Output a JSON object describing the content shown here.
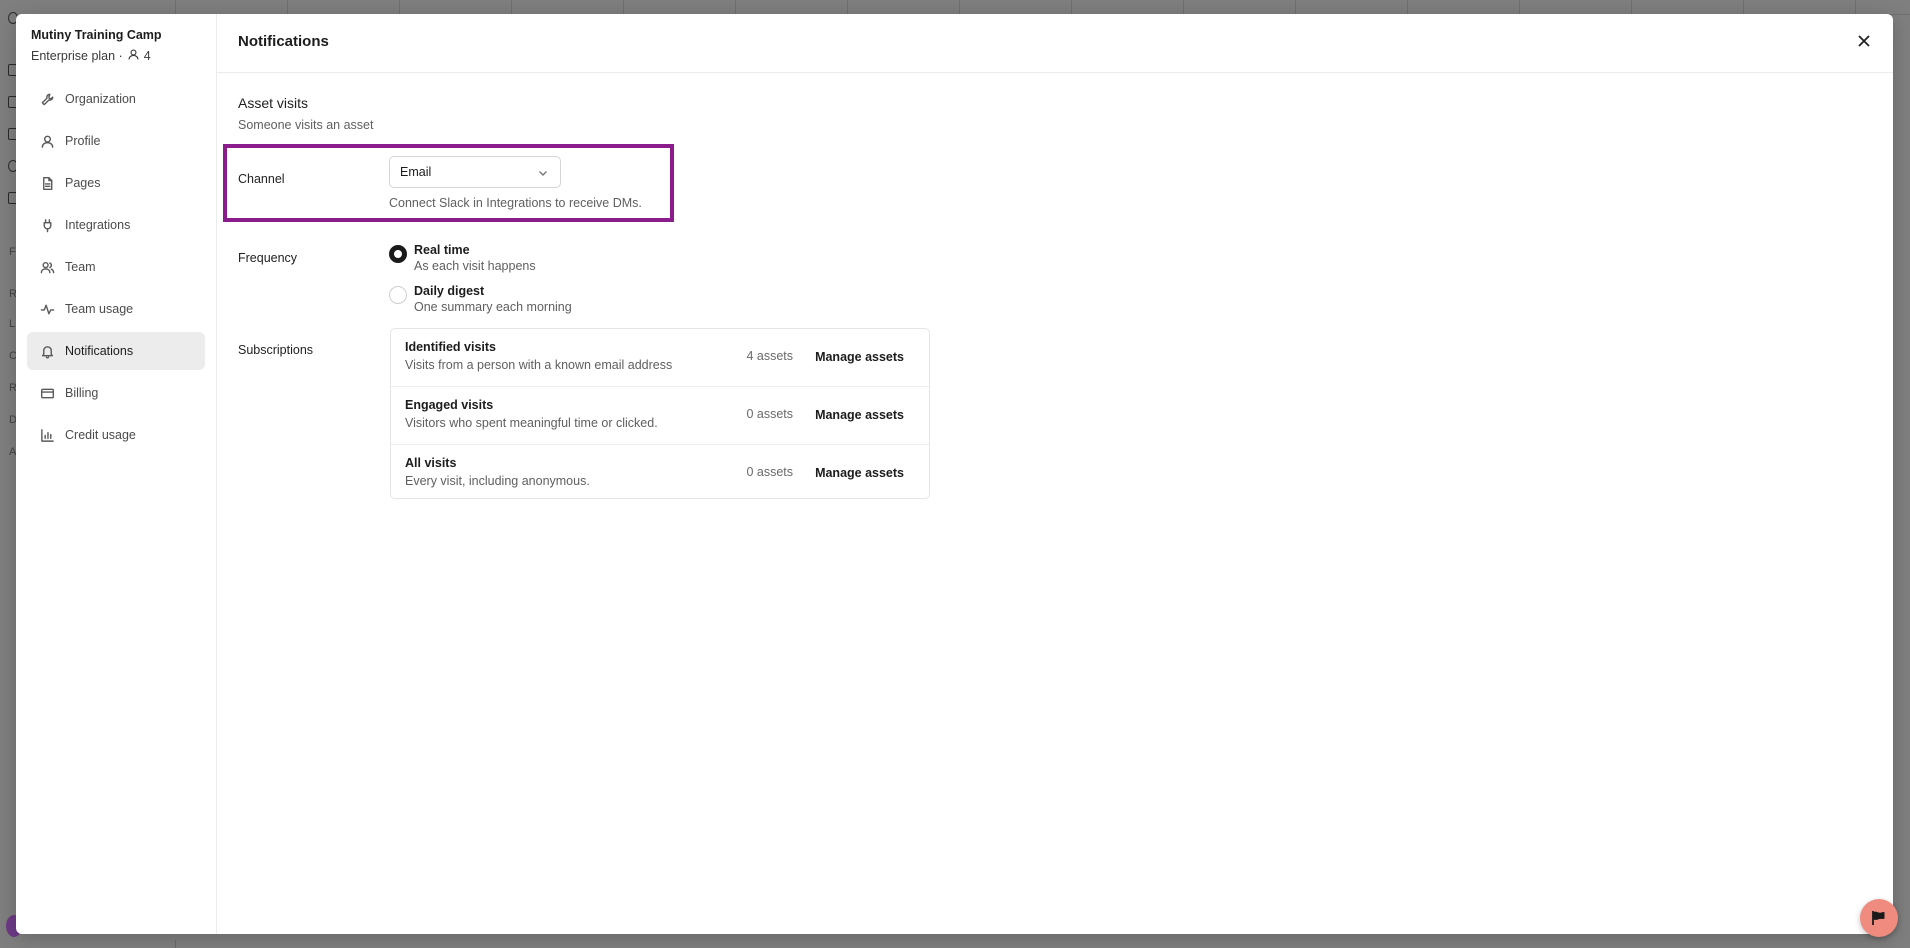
{
  "background": {
    "rail_letters": [
      "F",
      "R",
      "L",
      "C",
      "R",
      "D",
      "A"
    ]
  },
  "sidebar": {
    "org_name": "Mutiny Training Camp",
    "plan": "Enterprise plan ·",
    "member_count": "4",
    "items": [
      {
        "label": "Organization",
        "icon": "wrench-icon"
      },
      {
        "label": "Profile",
        "icon": "user-icon"
      },
      {
        "label": "Pages",
        "icon": "file-icon"
      },
      {
        "label": "Integrations",
        "icon": "plug-icon"
      },
      {
        "label": "Team",
        "icon": "users-icon"
      },
      {
        "label": "Team usage",
        "icon": "activity-icon"
      },
      {
        "label": "Notifications",
        "icon": "bell-icon",
        "active": true
      },
      {
        "label": "Billing",
        "icon": "credit-card-icon"
      },
      {
        "label": "Credit usage",
        "icon": "bar-chart-icon"
      }
    ]
  },
  "header": {
    "title": "Notifications"
  },
  "section": {
    "title": "Asset visits",
    "subtitle": "Someone visits an asset"
  },
  "channel": {
    "label": "Channel",
    "selected": "Email",
    "helper": "Connect Slack in Integrations to receive DMs."
  },
  "frequency": {
    "label": "Frequency",
    "options": [
      {
        "label": "Real time",
        "desc": "As each visit happens",
        "checked": true
      },
      {
        "label": "Daily digest",
        "desc": "One summary each morning",
        "checked": false
      }
    ]
  },
  "subscriptions": {
    "label": "Subscriptions",
    "rows": [
      {
        "name": "Identified visits",
        "desc": "Visits from a person with a known email address",
        "count": "4 assets",
        "action": "Manage assets"
      },
      {
        "name": "Engaged visits",
        "desc": "Visitors who spent meaningful time or clicked.",
        "count": "0 assets",
        "action": "Manage assets"
      },
      {
        "name": "All visits",
        "desc": "Every visit, including anonymous.",
        "count": "0 assets",
        "action": "Manage assets"
      }
    ]
  },
  "colors": {
    "highlight": "#8a1c8c",
    "fab": "#f08b80",
    "active_nav": "#ececec"
  }
}
